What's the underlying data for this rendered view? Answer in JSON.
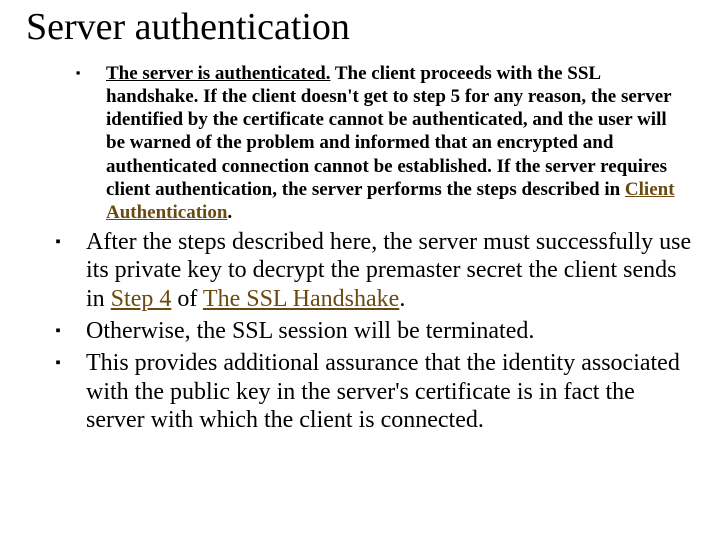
{
  "title": "Server authentication",
  "bullet_glyph": "▪",
  "para1": {
    "lead": "The server is authenticated.",
    "rest_a": " The client proceeds with the SSL handshake. If the client doesn't get to step 5 for any reason, the server identified by the certificate cannot be authenticated, and the user will be warned of the problem and informed that an encrypted and authenticated connection cannot be established. If the server requires client authentication, the server performs the steps described in ",
    "link": "Client Authentication",
    "rest_b": "."
  },
  "para2": {
    "text_a": "After the steps described here, the server must successfully use its private key to decrypt the premaster secret the client sends in ",
    "link1": "Step 4",
    "text_b": " of ",
    "link2": "The SSL Handshake",
    "text_c": "."
  },
  "para3": "Otherwise, the SSL session will be terminated.",
  "para4": "This provides additional assurance that the identity associated with the public key in the server's certificate is in fact the server with which the client is connected."
}
